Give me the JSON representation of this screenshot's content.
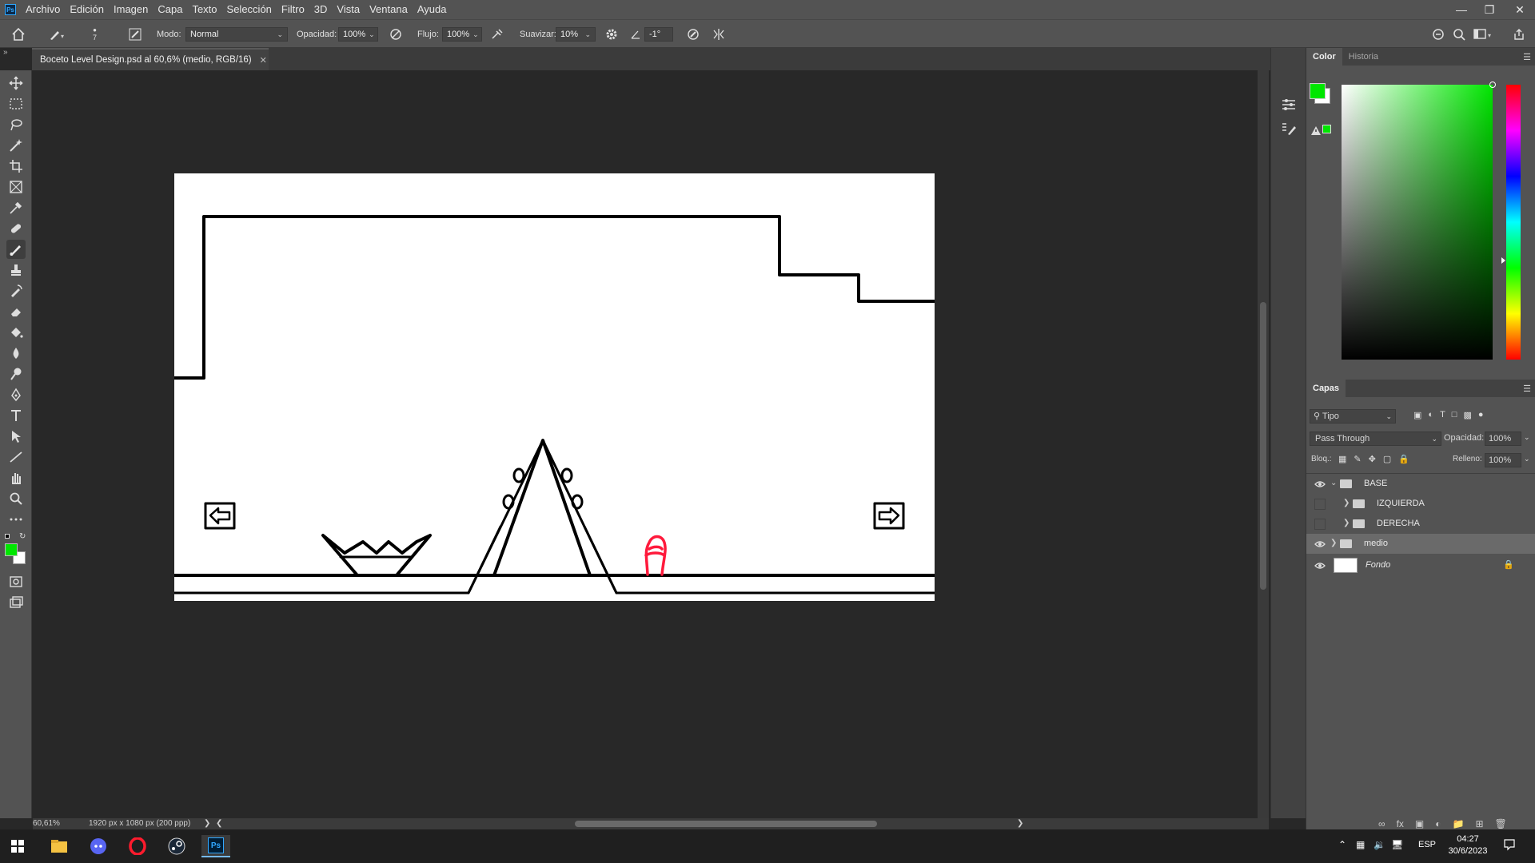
{
  "app": {
    "logo": "Ps"
  },
  "menubar": {
    "items": [
      "Archivo",
      "Edición",
      "Imagen",
      "Capa",
      "Texto",
      "Selección",
      "Filtro",
      "3D",
      "Vista",
      "Ventana",
      "Ayuda"
    ]
  },
  "options": {
    "brush_size": "7",
    "mode_label": "Modo:",
    "mode_value": "Normal",
    "opacity_label": "Opacidad:",
    "opacity_value": "100%",
    "flow_label": "Flujo:",
    "flow_value": "100%",
    "smooth_label": "Suavizar:",
    "smooth_value": "10%",
    "angle_value": "-1°"
  },
  "document": {
    "tab_title": "Boceto Level Design.psd al 60,6% (medio, RGB/16)"
  },
  "status": {
    "zoom": "60,61%",
    "info": "1920 px x 1080 px (200 ppp)"
  },
  "color_panel": {
    "tabs": [
      "Color",
      "Historia"
    ],
    "foreground": "#00e600",
    "background": "#ffffff"
  },
  "layers_panel": {
    "title": "Capas",
    "filter_value": "Tipo",
    "blend_mode": "Pass Through",
    "opacity_label": "Opacidad:",
    "opacity_value": "100%",
    "lock_label": "Bloq.:",
    "fill_label": "Relleno:",
    "fill_value": "100%",
    "layers": [
      {
        "name": "BASE",
        "type": "group",
        "visible": true,
        "expanded": true
      },
      {
        "name": "IZQUIERDA",
        "type": "group",
        "visible": false,
        "expanded": false
      },
      {
        "name": "DERECHA",
        "type": "group",
        "visible": false,
        "expanded": false
      },
      {
        "name": "medio",
        "type": "group",
        "visible": true,
        "expanded": false,
        "selected": true
      },
      {
        "name": "Fondo",
        "type": "layer",
        "visible": true,
        "locked": true
      }
    ]
  },
  "taskbar": {
    "lang": "ESP",
    "time": "04:27",
    "date": "30/6/2023"
  },
  "colors": {
    "sketch_stroke": "#000000",
    "character_stroke": "#ff1a3c",
    "accent": "#00e600"
  }
}
